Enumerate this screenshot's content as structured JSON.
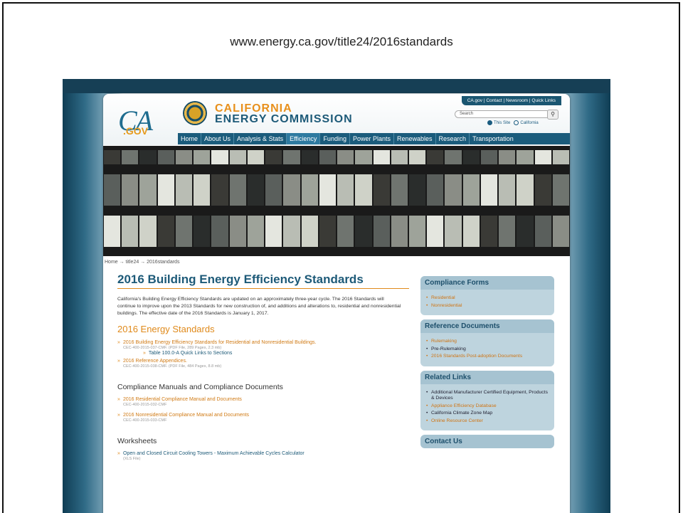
{
  "slide": {
    "url_caption": "www.energy.ca.gov/title24/2016standards"
  },
  "header": {
    "utility_links": "CA.gov | Contact | Newsroom | Quick Links",
    "logo_ca": "CA",
    "logo_gov": ".GOV",
    "org_line1": "CALIFORNIA",
    "org_line2": "ENERGY COMMISSION",
    "search_placeholder": "Search",
    "scope_this_site": "This Site",
    "scope_california": "California"
  },
  "nav": {
    "items": [
      "Home",
      "About Us",
      "Analysis & Stats",
      "Efficiency",
      "Funding",
      "Power Plants",
      "Renewables",
      "Research",
      "Transportation"
    ],
    "active_index": 3
  },
  "breadcrumb": "Home → title24 → 2016standards",
  "main": {
    "title": "2016 Building Energy Efficiency Standards",
    "intro": "California's Building Energy Efficiency Standards are updated on an approximately three-year cycle. The 2016 Standards will continue to improve upon the 2013 Standards for new construction of, and additions and alterations to, residential and nonresidential buildings. The effective date of the 2016 Standards is January 1, 2017.",
    "energy_heading": "2016 Energy Standards",
    "doc1": {
      "label": "2016 Building Energy Efficiency Standards for Residential and Nonresidential Buildings.",
      "sub": "CEC-400-2015-037-CMF. (PDF File, 289 Pages, 2.3 mb)",
      "child": "Table 100.0-A Quick Links to Sections"
    },
    "doc2": {
      "label": "2016 Reference Appendices.",
      "sub": "CEC-400-2015-038-CMF. (PDF File, 484 Pages, 8.8 mb)"
    },
    "manuals_heading": "Compliance Manuals and Compliance Documents",
    "doc3": {
      "label": "2016 Residential Compliance Manual and Documents",
      "sub": "CEC-400-2015-032-CMF"
    },
    "doc4": {
      "label": "2016 Nonresidential Compliance Manual and Documents",
      "sub": "CEC-400-2015-033-CMF"
    },
    "worksheets_heading": "Worksheets",
    "doc5": {
      "label": "Open and Closed Circuit Cooling Towers - Maximum Achievable Cycles Calculator",
      "sub": "(XLS File)"
    }
  },
  "sidebar": {
    "compliance_forms": {
      "title": "Compliance Forms",
      "links": [
        "Residential",
        "Nonresidential"
      ]
    },
    "reference_documents": {
      "title": "Reference Documents",
      "links": [
        "Rulemaking",
        "Pre-Rulemaking",
        "2016 Standards Post-adoption Documents"
      ]
    },
    "related_links": {
      "title": "Related Links",
      "links": [
        "Additional Manufacturer Certified Equipment, Products & Devices",
        "Appliance Efficiency Database",
        "California Climate Zone Map",
        "Online Resource Center"
      ]
    },
    "contact": {
      "title": "Contact Us"
    }
  }
}
